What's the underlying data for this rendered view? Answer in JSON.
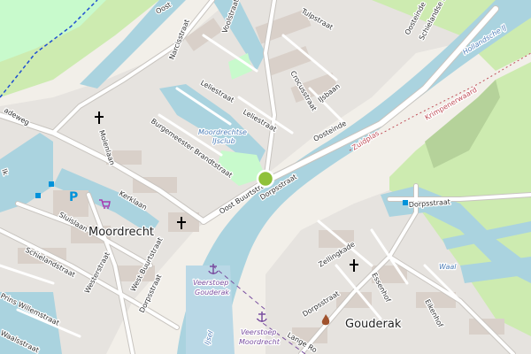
{
  "places": {
    "moordrecht": "Moordrecht",
    "gouderak": "Gouderak"
  },
  "streets": {
    "oost": "Oost",
    "voolstraat": "Voolstraat",
    "tulpstraat": "Tulpstraat",
    "narcisstraat": "Narcisstraat",
    "leliestraat_1": "Leliestraat",
    "leliestraat_2": "Leliestraat",
    "crocusstraat": "Crocusstraat",
    "ijsbaan": "IJsbaan",
    "oosteinde": "Oosteinde",
    "molenlaan": "Molenlaan",
    "burgemeester_brandtstraat": "Burgemeester Brandtstraat",
    "oost_buurtstraat": "Oost Buurtstraat",
    "dorpsstraat_1": "Dorpsstraat",
    "kerklaan": "Kerklaan",
    "sluislaan": "Sluislaan",
    "schielandstraat": "Schielandstraat",
    "prins_willemstraat": "Prins Willemstraat",
    "westerstraat": "Westerstraat",
    "west_buurtstraat": "West Buurtstraat",
    "dorpsstraat_2": "Dorpsstraat",
    "waalsstraat": "Waalsstraat",
    "dorpsstraat_3": "Dorpsstraat",
    "zellingkade": "Zellingkade",
    "dorpsstraat_4": "Dorpsstraat",
    "essenhof": "Essenhof",
    "eikenhof": "Eikenhof",
    "lange_ro": "Lange Ro",
    "oosteinde_ne": "Oosteinde",
    "schielandse_hoge": "Schielandse Hog",
    "kadeweg": "adeweg",
    "lk": "lk"
  },
  "water": {
    "hollandse_ijssel": "Hollandsche IJ",
    "waal": "Waal",
    "ijssel": "Ijsel"
  },
  "pois": {
    "ijsclub_line1": "Moordrechtse",
    "ijsclub_line2": "IJsclub",
    "veerstoep_moordrecht_1": "Veerstoep",
    "veerstoep_moordrecht_2": "Moordrecht",
    "veerstoep_gouderak_1": "Veerstoep",
    "veerstoep_gouderak_2": "Gouderak",
    "parking": "P"
  },
  "rail": {
    "zuidplas": "Zuidplas",
    "krimpenerwaard": "Krimpenerwaard"
  },
  "colors": {
    "land": "#f2efe9",
    "residential": "#e0dfdf",
    "building": "#d9d0c9",
    "water": "#aad3df",
    "park": "#c8facc",
    "meadow": "#cdebb0",
    "road": "#ffffff",
    "road_casing": "#c8c4bf",
    "primary_road": "#fcd6a4",
    "church_symbol": "#000000",
    "marker": "#8fc13a",
    "ferry": "#7a4fa0",
    "parking": "#0092da"
  }
}
